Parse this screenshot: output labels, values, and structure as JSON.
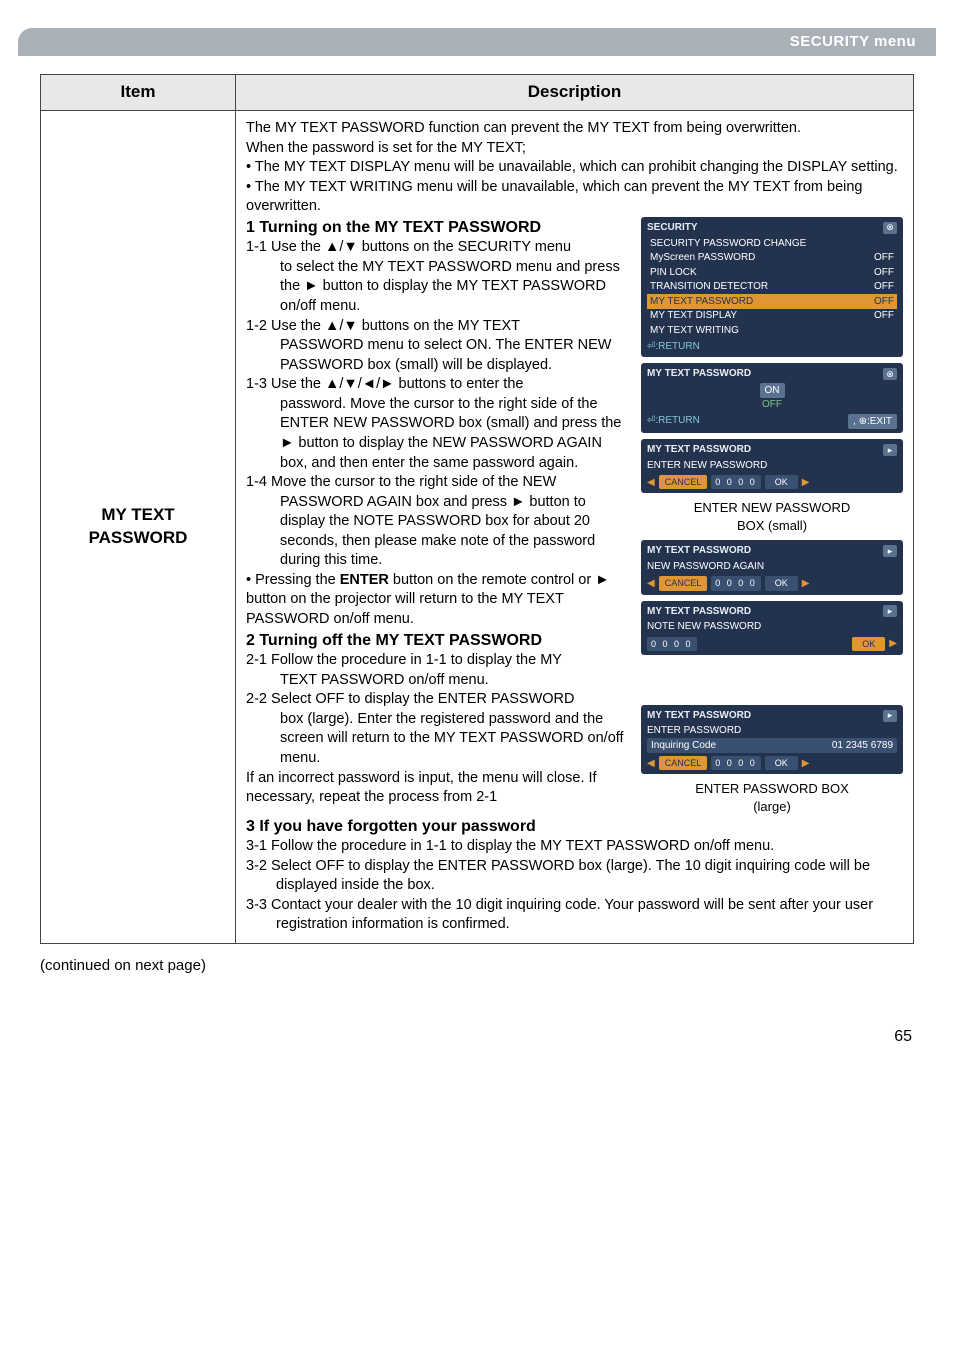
{
  "header": {
    "section_title": "SECURITY menu"
  },
  "table": {
    "col1_header": "Item",
    "col2_header": "Description",
    "item_label_line1": "MY TEXT",
    "item_label_line2": "PASSWORD"
  },
  "intro": {
    "p1": "The MY TEXT PASSWORD function can prevent the MY TEXT from being overwritten.",
    "p2": "When the password is set for the MY TEXT;",
    "p3": "• The MY TEXT DISPLAY menu will be unavailable, which can prohibit changing the DISPLAY setting.",
    "p4": "• The MY TEXT WRITING menu will be unavailable, which can prevent the MY TEXT from being overwritten."
  },
  "sec1": {
    "heading": "1 Turning on the MY TEXT PASSWORD",
    "s1_1a": "1-1 Use the ▲/▼ buttons on the SECURITY menu",
    "s1_1b": "to select the MY TEXT PASSWORD menu and press the ► button to display the MY TEXT PASSWORD on/off menu.",
    "s1_2a": "1-2 Use the ▲/▼ buttons on the MY TEXT",
    "s1_2b": "PASSWORD menu to select ON. The ENTER NEW PASSWORD box (small) will be displayed.",
    "s1_3a": "1-3 Use the ▲/▼/◄/► buttons to enter the",
    "s1_3b": "password. Move the cursor to the right side of the ENTER NEW PASSWORD box (small) and press the ► button to display the NEW PASSWORD AGAIN box, and then enter the same password again.",
    "s1_4a": "1-4 Move the cursor to the right side of the NEW",
    "s1_4b": "PASSWORD AGAIN box and press ► button to display the NOTE PASSWORD box for about 20 seconds, then please make note of the password during this time.",
    "s1_note": "• Pressing the ENTER button on the remote control or ► button on the projector will return to the MY TEXT PASSWORD on/off menu.",
    "enter_label": "ENTER"
  },
  "sec2": {
    "heading": "2 Turning off the MY TEXT PASSWORD",
    "s2_1a": "2-1 Follow the procedure in 1-1 to display the MY",
    "s2_1b": "TEXT PASSWORD on/off menu.",
    "s2_2a": "2-2 Select OFF to display the ENTER PASSWORD",
    "s2_2b": "box (large). Enter the registered password and the screen will return to the MY TEXT PASSWORD on/off menu.",
    "s2_note": "If an incorrect password is input, the menu will close. If necessary, repeat the process from 2-1"
  },
  "sec3": {
    "heading": "3 If you have forgotten your password",
    "s3_1": "3-1 Follow the procedure in 1-1 to display the MY TEXT PASSWORD on/off menu.",
    "s3_2": "3-2 Select OFF to display the ENTER PASSWORD box (large). The 10 digit inquiring code will be displayed inside the box.",
    "s3_3": "3-3 Contact your dealer with the 10 digit inquiring code. Your password will be sent after your user registration information is confirmed."
  },
  "widgets": {
    "security_menu": {
      "title": "SECURITY",
      "r1": {
        "l": "SECURITY PASSWORD CHANGE",
        "v": ""
      },
      "r2": {
        "l": "MyScreen PASSWORD",
        "v": "OFF"
      },
      "r3": {
        "l": "PIN LOCK",
        "v": "OFF"
      },
      "r4": {
        "l": "TRANSITION DETECTOR",
        "v": "OFF"
      },
      "r5": {
        "l": "MY TEXT PASSWORD",
        "v": "OFF"
      },
      "r6": {
        "l": "MY TEXT DISPLAY",
        "v": "OFF"
      },
      "r7": {
        "l": "MY TEXT WRITING",
        "v": ""
      },
      "foot": "⏎:RETURN"
    },
    "onoff": {
      "title": "MY TEXT PASSWORD",
      "on": "ON",
      "off": "OFF",
      "ret": "⏎:RETURN",
      "exit": ", ⊕:EXIT"
    },
    "enter_new_small": {
      "title": "MY TEXT PASSWORD",
      "row": "ENTER NEW PASSWORD",
      "cancel": "CANCEL",
      "digits": "0 0 0 0",
      "ok": "OK",
      "caption_l1": "ENTER NEW PASSWORD",
      "caption_l2": "BOX (small)"
    },
    "again": {
      "title": "MY TEXT PASSWORD",
      "row": "NEW PASSWORD AGAIN",
      "cancel": "CANCEL",
      "digits": "0 0 0 0",
      "ok": "OK"
    },
    "note_pw": {
      "title": "MY TEXT PASSWORD",
      "row": "NOTE NEW PASSWORD",
      "digits": "0 0 0 0",
      "ok": "OK"
    },
    "enter_large": {
      "title": "MY TEXT PASSWORD",
      "row1": "ENTER PASSWORD",
      "row2l": "Inquiring Code",
      "row2r": "01 2345 6789",
      "cancel": "CANCEL",
      "digits": "0 0 0 0",
      "ok": "OK",
      "caption_l1": "ENTER PASSWORD BOX",
      "caption_l2": "(large)"
    }
  },
  "continued": "(continued on next page)",
  "page_number": "65"
}
